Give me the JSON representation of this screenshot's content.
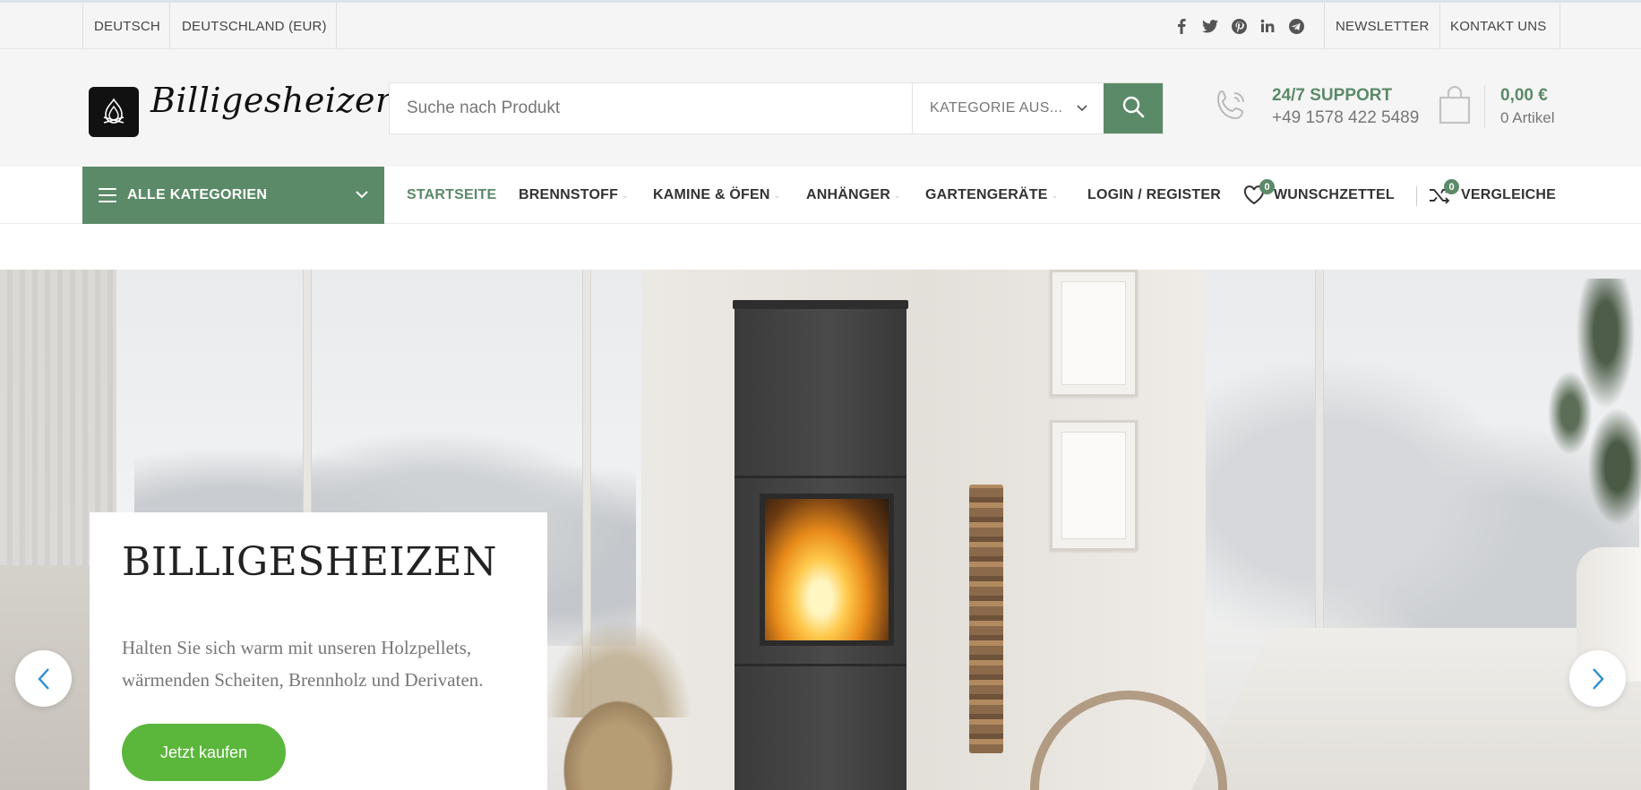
{
  "topbar": {
    "language": "DEUTSCH",
    "currency": "DEUTSCHLAND (EUR)",
    "social_icons": [
      "facebook-icon",
      "twitter-icon",
      "pinterest-icon",
      "linkedin-icon",
      "telegram-icon"
    ],
    "newsletter": "NEWSLETTER",
    "contact": "KONTAKT UNS"
  },
  "header": {
    "logo_text": "Billigesheizen",
    "search_placeholder": "Suche nach Produkt",
    "category_select": "KATEGORIE AUS...",
    "support_title": "24/7 SUPPORT",
    "support_phone": "+49 1578 422 5489",
    "cart_total": "0,00 €",
    "cart_items": "0 Artikel"
  },
  "nav": {
    "all_categories": "ALLE KATEGORIEN",
    "items": [
      "STARTSEITE",
      "BRENNSTOFF",
      "KAMINE & ÖFEN",
      "ANHÄNGER",
      "GARTENGERÄTE"
    ],
    "login": "LOGIN / REGISTER",
    "wishlist": "WUNSCHZETTEL",
    "wishlist_count": "0",
    "compare": "VERGLEICHE",
    "compare_count": "0"
  },
  "hero": {
    "title": "BILLIGESHEIZEN",
    "text": "Halten Sie sich warm mit unseren Holzpellets, wärmenden Scheiten, Brennholz und Derivaten.",
    "button": "Jetzt kaufen"
  },
  "colors": {
    "accent": "#5b8a68",
    "button_green": "#5bb63c",
    "slider_arrow": "#2a8fd1"
  }
}
